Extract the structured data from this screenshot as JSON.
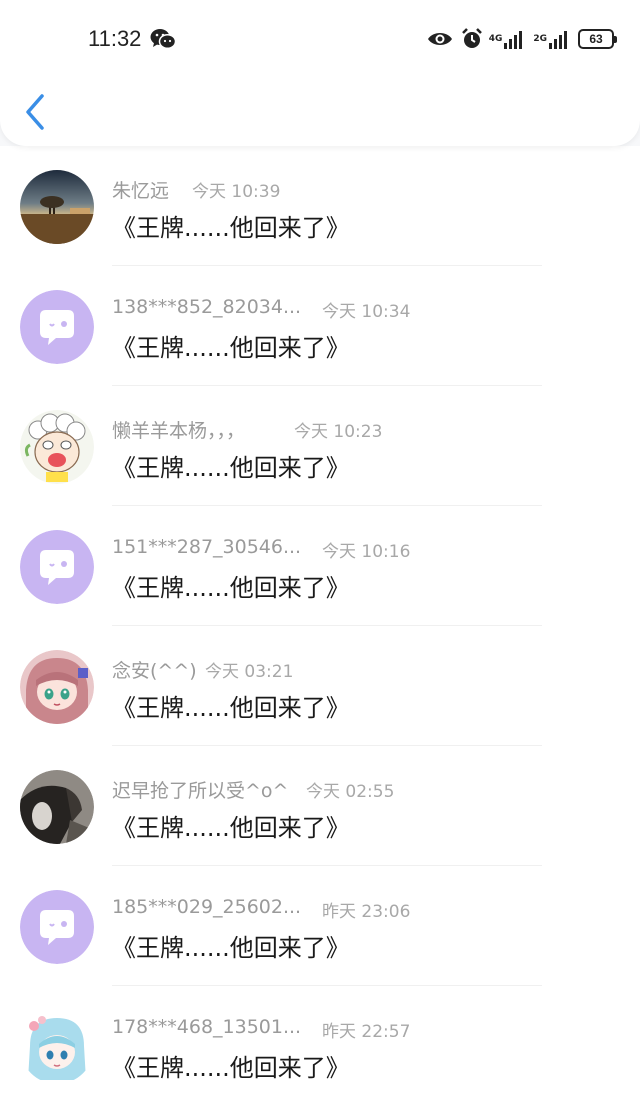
{
  "status_bar": {
    "time": "11:32",
    "network_1": "4G",
    "network_2": "2G",
    "battery": "63"
  },
  "comments": [
    {
      "name": "朱忆远",
      "time": "今天 10:39",
      "message": "《王牌......他回来了》",
      "avatar": "landscape-tree-avatar"
    },
    {
      "name": "138***852_82034...",
      "time": "今天 10:34",
      "message": "《王牌......他回来了》",
      "avatar": "default-chat-avatar"
    },
    {
      "name": "懒羊羊本杨，，，",
      "time": "今天 10:23",
      "message": "《王牌......他回来了》",
      "avatar": "sheep-cartoon-avatar"
    },
    {
      "name": "151***287_30546...",
      "time": "今天 10:16",
      "message": "《王牌......他回来了》",
      "avatar": "default-chat-avatar"
    },
    {
      "name": "念安(^^)",
      "time": "今天 03:21",
      "message": "《王牌......他回来了》",
      "avatar": "anime-girl-avatar"
    },
    {
      "name": "迟早抢了所以受^o^",
      "time": "今天 02:55",
      "message": "《王牌......他回来了》",
      "avatar": "dark-photo-avatar"
    },
    {
      "name": "185***029_25602...",
      "time": "昨天 23:06",
      "message": "《王牌......他回来了》",
      "avatar": "default-chat-avatar"
    },
    {
      "name": "178***468_13501...",
      "time": "昨天 22:57",
      "message": "《王牌......他回来了》",
      "avatar": "blue-hair-anime-avatar"
    }
  ],
  "colors": {
    "accent": "#3a8ee6",
    "default_avatar_bg": "#c8b5f2"
  }
}
